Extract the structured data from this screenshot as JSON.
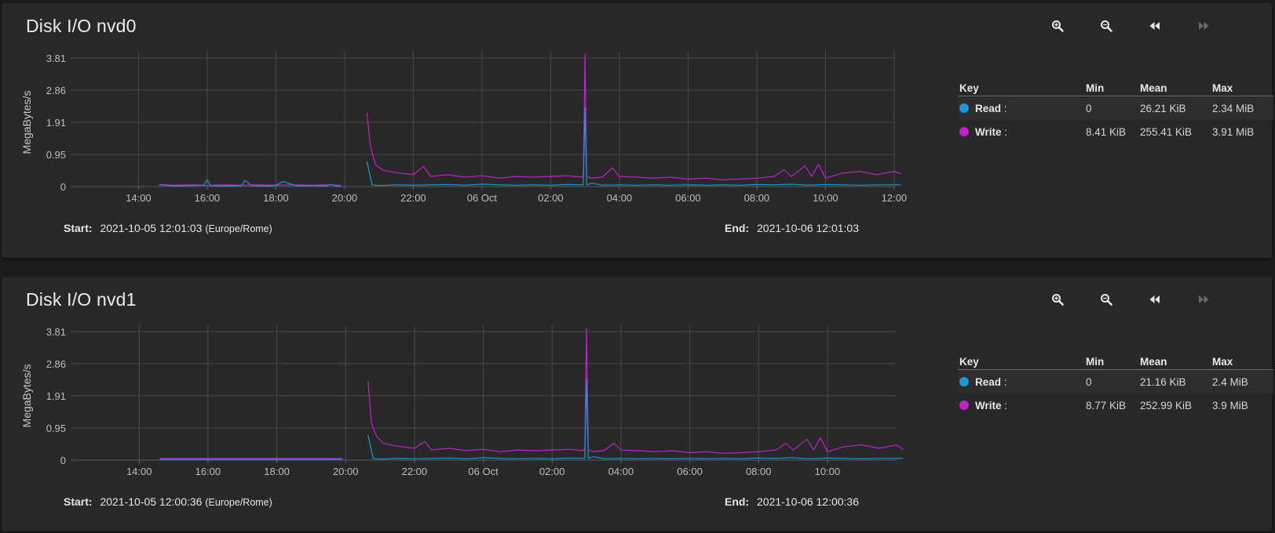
{
  "colors": {
    "read": "#1a98d8",
    "write": "#c41fd0",
    "background": "#1b1b1b",
    "card": "#282828"
  },
  "toolbar": {
    "zoom_in_icon": "zoom-in-icon",
    "zoom_out_icon": "zoom-out-icon",
    "back_icon": "rewind-icon",
    "forward_icon": "fast-forward-icon"
  },
  "charts": [
    {
      "title": "Disk I/O nvd0",
      "start_label": "Start:",
      "start_value": "2021-10-05 12:01:03",
      "timezone": "(Europe/Rome)",
      "end_label": "End:",
      "end_value": "2021-10-06 12:01:03",
      "legend": {
        "headers": {
          "key": "Key",
          "min": "Min",
          "mean": "Mean",
          "max": "Max"
        },
        "rows": [
          {
            "name": "Read",
            "sep": ":",
            "min": "0",
            "mean": "26.21 KiB",
            "max": "2.34 MiB"
          },
          {
            "name": "Write",
            "sep": ":",
            "min": "8.41 KiB",
            "mean": "255.41 KiB",
            "max": "3.91 MiB"
          }
        ]
      }
    },
    {
      "title": "Disk I/O nvd1",
      "start_label": "Start:",
      "start_value": "2021-10-05 12:00:36",
      "timezone": "(Europe/Rome)",
      "end_label": "End:",
      "end_value": "2021-10-06 12:00:36",
      "legend": {
        "headers": {
          "key": "Key",
          "min": "Min",
          "mean": "Mean",
          "max": "Max"
        },
        "rows": [
          {
            "name": "Read",
            "sep": ":",
            "min": "0",
            "mean": "21.16 KiB",
            "max": "2.4 MiB"
          },
          {
            "name": "Write",
            "sep": ":",
            "min": "8.77 KiB",
            "mean": "252.99 KiB",
            "max": "3.9 MiB"
          }
        ]
      }
    }
  ],
  "chart_data": [
    {
      "type": "line",
      "title": "Disk I/O nvd0",
      "ylabel": "MegaBytes/s",
      "xlabel": "",
      "x_start": "2021-10-05 12:01:03",
      "x_end": "2021-10-06 12:01:03",
      "ylim": [
        0,
        4.0
      ],
      "y_ticks": [
        0,
        0.95,
        1.91,
        2.86,
        3.81
      ],
      "y_tick_labels": [
        "0",
        "0.95",
        "1.91",
        "2.86",
        "3.81"
      ],
      "x_tick_labels": [
        "14:00",
        "16:00",
        "18:00",
        "20:00",
        "22:00",
        "06 Oct",
        "02:00",
        "04:00",
        "06:00",
        "08:00",
        "10:00",
        "12:00"
      ],
      "x_tick_hours": [
        14,
        16,
        18,
        20,
        22,
        24,
        26,
        28,
        30,
        32,
        34,
        36
      ],
      "grid": true,
      "series": [
        {
          "name": "Read",
          "color": "#1a98d8",
          "x": [
            14.6,
            15.0,
            15.5,
            15.9,
            16.0,
            16.1,
            16.5,
            17.0,
            17.1,
            17.3,
            17.8,
            18.0,
            18.2,
            18.6,
            19.0,
            19.5,
            19.6,
            19.7,
            19.9,
            20.0,
            20.6,
            20.65,
            20.8,
            21.0,
            21.5,
            22.0,
            22.5,
            23.0,
            23.5,
            24.0,
            24.5,
            25.0,
            25.5,
            26.0,
            26.5,
            26.95,
            27.0,
            27.05,
            27.2,
            27.5,
            28.0,
            28.5,
            29.0,
            29.5,
            30.0,
            30.5,
            31.0,
            31.5,
            32.0,
            32.5,
            33.0,
            33.3,
            33.5,
            34.0,
            34.5,
            35.0,
            35.5,
            36.0,
            36.2
          ],
          "y": [
            0.05,
            0.02,
            0.03,
            0.04,
            0.2,
            0.03,
            0.02,
            0.03,
            0.18,
            0.03,
            0.02,
            0.03,
            0.15,
            0.02,
            0.03,
            0.02,
            0.07,
            0.02,
            0.01,
            null,
            null,
            0.75,
            0.05,
            0.03,
            0.05,
            0.04,
            0.05,
            0.06,
            0.04,
            0.07,
            0.05,
            0.04,
            0.05,
            0.04,
            0.06,
            0.05,
            2.34,
            0.05,
            0.1,
            0.04,
            0.05,
            0.04,
            0.05,
            0.04,
            0.05,
            0.04,
            0.05,
            0.04,
            0.06,
            0.05,
            0.07,
            0.05,
            0.04,
            0.06,
            0.05,
            0.04,
            0.05,
            0.05,
            0.05
          ]
        },
        {
          "name": "Write",
          "color": "#c41fd0",
          "x": [
            14.6,
            15.0,
            15.5,
            16.0,
            16.5,
            17.0,
            17.5,
            18.0,
            18.5,
            19.0,
            19.5,
            19.9,
            20.0,
            20.6,
            20.65,
            20.75,
            20.9,
            21.1,
            21.3,
            21.6,
            22.0,
            22.3,
            22.5,
            23.0,
            23.5,
            24.0,
            24.5,
            25.0,
            25.5,
            26.0,
            26.5,
            26.9,
            26.95,
            27.0,
            27.05,
            27.2,
            27.5,
            27.8,
            28.0,
            28.5,
            29.0,
            29.5,
            30.0,
            30.5,
            31.0,
            31.5,
            32.0,
            32.5,
            32.8,
            33.0,
            33.2,
            33.4,
            33.6,
            33.8,
            34.0,
            34.5,
            35.0,
            35.5,
            36.0,
            36.2
          ],
          "y": [
            0.06,
            0.04,
            0.05,
            0.04,
            0.05,
            0.04,
            0.05,
            0.04,
            0.05,
            0.04,
            0.05,
            0.04,
            null,
            null,
            2.2,
            1.2,
            0.65,
            0.5,
            0.45,
            0.4,
            0.35,
            0.6,
            0.3,
            0.35,
            0.28,
            0.32,
            0.25,
            0.3,
            0.28,
            0.3,
            0.32,
            0.28,
            0.35,
            3.91,
            0.3,
            0.25,
            0.28,
            0.55,
            0.3,
            0.28,
            0.25,
            0.28,
            0.22,
            0.25,
            0.2,
            0.22,
            0.25,
            0.3,
            0.5,
            0.3,
            0.45,
            0.62,
            0.3,
            0.66,
            0.25,
            0.4,
            0.45,
            0.35,
            0.45,
            0.38
          ]
        }
      ]
    },
    {
      "type": "line",
      "title": "Disk I/O nvd1",
      "ylabel": "MegaBytes/s",
      "xlabel": "",
      "x_start": "2021-10-05 12:00:36",
      "x_end": "2021-10-06 12:00:36",
      "ylim": [
        0,
        4.0
      ],
      "y_ticks": [
        0,
        0.95,
        1.91,
        2.86,
        3.81
      ],
      "y_tick_labels": [
        "0",
        "0.95",
        "1.91",
        "2.86",
        "3.81"
      ],
      "x_tick_labels": [
        "14:00",
        "16:00",
        "18:00",
        "20:00",
        "22:00",
        "06 Oct",
        "02:00",
        "04:00",
        "06:00",
        "08:00",
        "10:00"
      ],
      "x_tick_hours": [
        14,
        16,
        18,
        20,
        22,
        24,
        26,
        28,
        30,
        32,
        34
      ],
      "grid": true,
      "series": [
        {
          "name": "Read",
          "color": "#1a98d8",
          "x": [
            14.6,
            15.0,
            15.5,
            16.0,
            16.5,
            17.0,
            17.5,
            18.0,
            18.5,
            19.0,
            19.5,
            19.9,
            20.0,
            20.6,
            20.65,
            20.8,
            21.0,
            21.5,
            22.0,
            22.5,
            23.0,
            23.5,
            24.0,
            24.5,
            25.0,
            25.5,
            26.0,
            26.5,
            26.95,
            27.0,
            27.05,
            27.2,
            27.5,
            28.0,
            28.5,
            29.0,
            29.5,
            30.0,
            30.5,
            31.0,
            31.5,
            32.0,
            32.5,
            33.0,
            33.3,
            33.5,
            34.0,
            34.5,
            35.0,
            35.5,
            36.0,
            36.2
          ],
          "y": [
            0.02,
            0.02,
            0.02,
            0.02,
            0.02,
            0.02,
            0.02,
            0.02,
            0.02,
            0.02,
            0.02,
            0.02,
            null,
            null,
            0.75,
            0.05,
            0.03,
            0.05,
            0.04,
            0.05,
            0.06,
            0.04,
            0.07,
            0.05,
            0.04,
            0.05,
            0.04,
            0.06,
            0.05,
            2.4,
            0.05,
            0.1,
            0.04,
            0.05,
            0.04,
            0.05,
            0.04,
            0.05,
            0.04,
            0.05,
            0.04,
            0.06,
            0.05,
            0.07,
            0.05,
            0.04,
            0.06,
            0.05,
            0.04,
            0.05,
            0.05,
            0.05
          ]
        },
        {
          "name": "Write",
          "color": "#c41fd0",
          "x": [
            14.6,
            15.0,
            15.5,
            16.0,
            16.5,
            17.0,
            17.5,
            18.0,
            18.5,
            19.0,
            19.5,
            19.9,
            20.0,
            20.6,
            20.65,
            20.75,
            20.9,
            21.1,
            21.3,
            21.6,
            22.0,
            22.3,
            22.5,
            23.0,
            23.5,
            24.0,
            24.5,
            25.0,
            25.5,
            26.0,
            26.5,
            26.9,
            26.95,
            27.0,
            27.05,
            27.2,
            27.5,
            27.8,
            28.0,
            28.5,
            29.0,
            29.5,
            30.0,
            30.5,
            31.0,
            31.5,
            32.0,
            32.5,
            32.8,
            33.0,
            33.2,
            33.4,
            33.6,
            33.8,
            34.0,
            34.5,
            35.0,
            35.5,
            36.0,
            36.2
          ],
          "y": [
            0.05,
            0.05,
            0.05,
            0.05,
            0.05,
            0.05,
            0.05,
            0.05,
            0.05,
            0.05,
            0.05,
            0.05,
            null,
            null,
            2.35,
            1.1,
            0.7,
            0.5,
            0.45,
            0.4,
            0.35,
            0.55,
            0.3,
            0.35,
            0.28,
            0.32,
            0.25,
            0.3,
            0.28,
            0.3,
            0.32,
            0.28,
            0.35,
            3.9,
            0.3,
            0.25,
            0.28,
            0.5,
            0.3,
            0.28,
            0.25,
            0.28,
            0.22,
            0.25,
            0.2,
            0.22,
            0.25,
            0.3,
            0.5,
            0.3,
            0.45,
            0.62,
            0.3,
            0.66,
            0.25,
            0.4,
            0.45,
            0.35,
            0.45,
            0.32
          ]
        }
      ]
    }
  ]
}
